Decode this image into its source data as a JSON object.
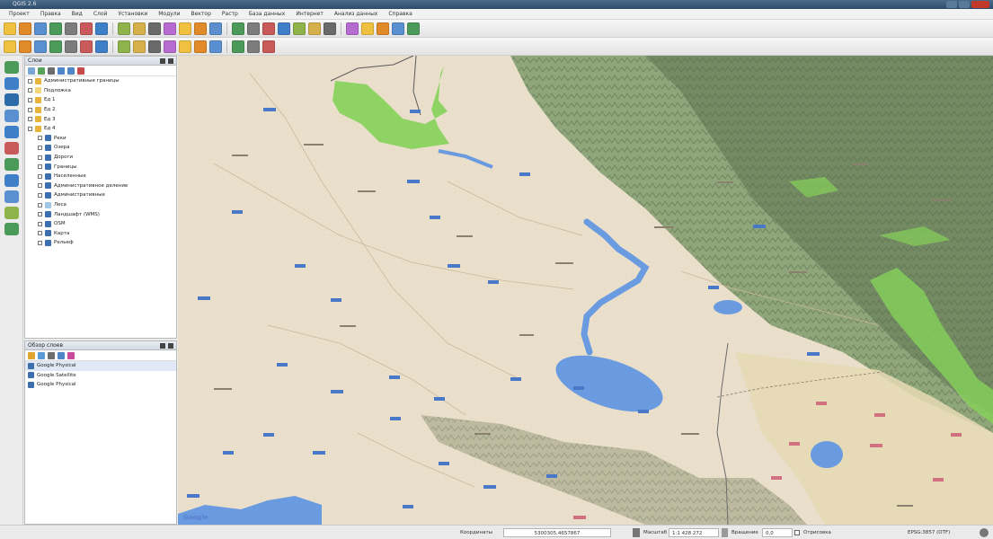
{
  "window": {
    "title": "QGIS 2.6"
  },
  "menubar": {
    "items": [
      "Проект",
      "Правка",
      "Вид",
      "Слой",
      "Установки",
      "Модули",
      "Вектор",
      "Растр",
      "База данных",
      "Интернет",
      "Анализ данных",
      "Справка"
    ]
  },
  "toolbar_top": {
    "icons": [
      "new-icon",
      "open-icon",
      "save-icon",
      "save-as-icon",
      "print-icon",
      "print-composer-icon",
      "pan-icon",
      "pan-to-selection-icon",
      "zoom-in-icon",
      "zoom-out-icon",
      "zoom-full-icon",
      "zoom-layer-icon",
      "zoom-selection-icon",
      "zoom-last-icon",
      "zoom-next-icon",
      "refresh-icon",
      "identify-icon",
      "select-icon",
      "deselect-icon",
      "attribute-table-icon",
      "field-calculator-icon",
      "measure-icon",
      "text-annotation-icon",
      "map-tips-icon",
      "bookmark-icon",
      "help-icon"
    ]
  },
  "toolbar_second": {
    "icons": [
      "edit-icon",
      "pencil-icon",
      "save-edits-icon",
      "add-feature-icon",
      "move-feature-icon",
      "node-tool-icon",
      "delete-selected-icon",
      "cut-icon",
      "copy-icon",
      "paste-icon",
      "label-icon",
      "pin-label-icon",
      "show-label-icon",
      "move-label-icon",
      "rotate-label-icon",
      "change-label-icon",
      "python-icon"
    ]
  },
  "left_tools": {
    "icons": [
      "add-vector-icon",
      "add-raster-icon",
      "add-postgis-icon",
      "add-spatialite-icon",
      "add-mssql-icon",
      "add-oracle-icon",
      "add-wms-icon",
      "add-wcs-icon",
      "add-wfs-icon",
      "add-delimited-text-icon",
      "new-shapefile-icon"
    ]
  },
  "layers_panel": {
    "title": "Слои",
    "items": [
      {
        "label": "Административные границы",
        "type": "group",
        "color": "#e7b33b"
      },
      {
        "label": "Подложка",
        "type": "group",
        "color": "#f3d77a"
      },
      {
        "label": "Ед 1",
        "type": "group",
        "color": "#e7b33b"
      },
      {
        "label": "Ед 2",
        "type": "group",
        "color": "#e7b33b"
      },
      {
        "label": "Ед 3",
        "type": "group",
        "color": "#e7b33b"
      },
      {
        "label": "Ед 4",
        "type": "group",
        "color": "#e7b33b"
      },
      {
        "label": "Реки",
        "type": "layer",
        "color": "#3d6fb0"
      },
      {
        "label": "Озера",
        "type": "layer",
        "color": "#3d6fb0"
      },
      {
        "label": "Дороги",
        "type": "layer",
        "color": "#3d6fb0"
      },
      {
        "label": "Границы",
        "type": "layer",
        "color": "#3d6fb0"
      },
      {
        "label": "Населенные",
        "type": "layer",
        "color": "#3d6fb0"
      },
      {
        "label": "Административное деление",
        "type": "layer",
        "color": "#3d6fb0"
      },
      {
        "label": "Административные",
        "type": "layer",
        "color": "#3d6fb0"
      },
      {
        "label": "Леса",
        "type": "layer",
        "color": "#9fc7e7"
      },
      {
        "label": "Ландшафт (WMS)",
        "type": "layer",
        "color": "#3d6fb0"
      },
      {
        "label": "OSM",
        "type": "layer",
        "color": "#3d6fb0"
      },
      {
        "label": "Карта",
        "type": "layer",
        "color": "#3d6fb0"
      },
      {
        "label": "Рельеф",
        "type": "layer",
        "color": "#3d6fb0"
      }
    ]
  },
  "browser_panel": {
    "title": "Обзор слоев",
    "items": [
      {
        "label": "Google Physical"
      },
      {
        "label": "Google Satellite"
      },
      {
        "label": "Google Physical"
      }
    ]
  },
  "map": {
    "attribution": "Google"
  },
  "statusbar": {
    "coordinate_label": "Координаты",
    "coordinate_value": "5300305,4657867",
    "scale_label": "Масштаб",
    "scale_value": "1:1 428 272",
    "rotation_label": "Вращение",
    "rotation_value": "0,0",
    "render_label": "Отрисовка",
    "crs_value": "EPSG:3857 (OTF)"
  },
  "colors": {
    "map_plain": "#e9dfcb",
    "map_mountain": "#7f9a6c",
    "water": "#6a9be0",
    "forest": "#86d25a",
    "accent": "#3d6fb0"
  }
}
